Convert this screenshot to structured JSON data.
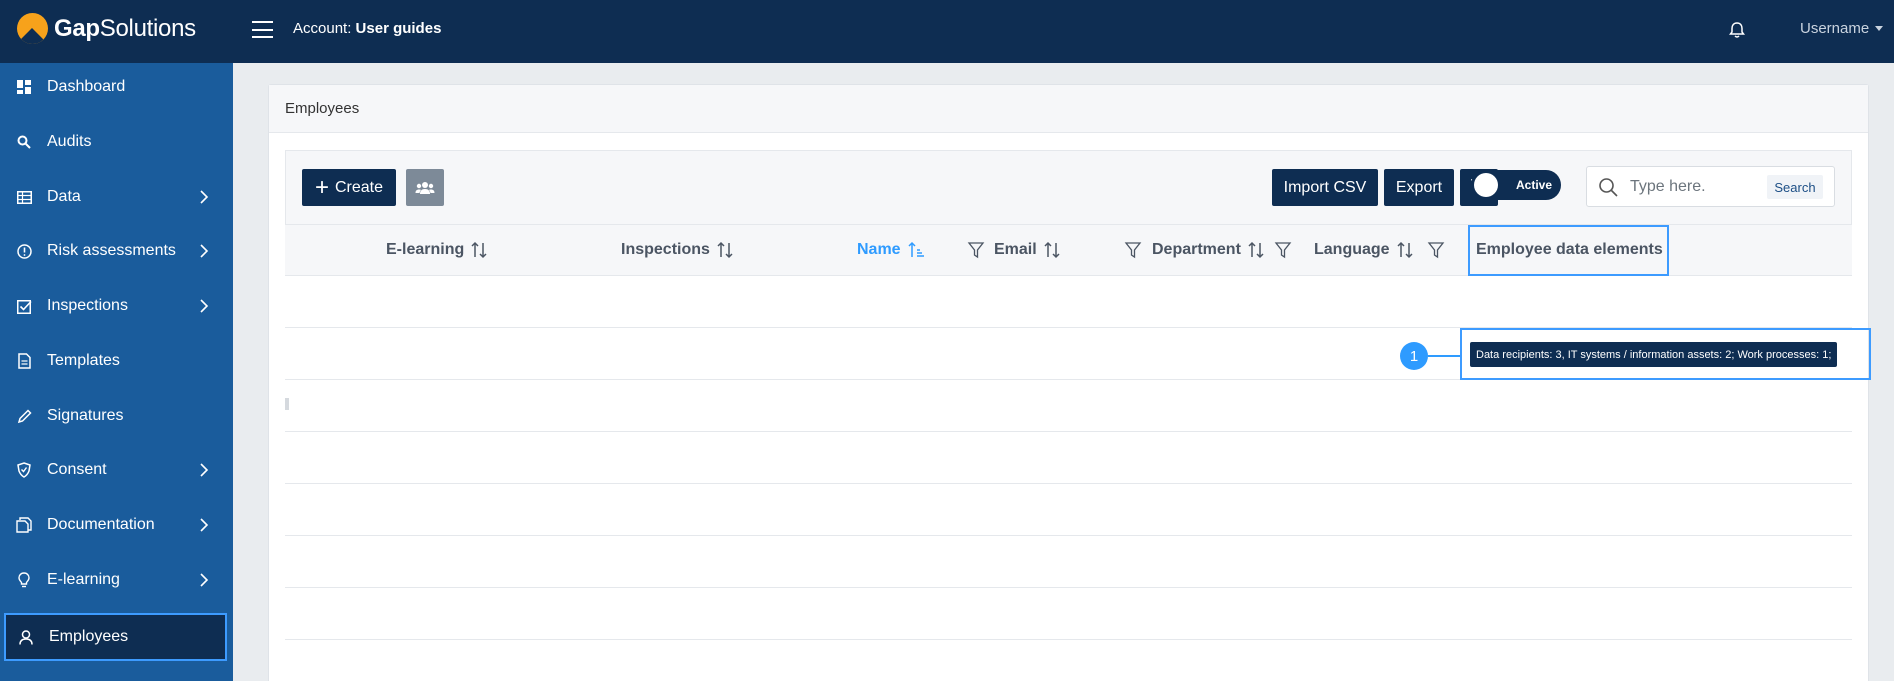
{
  "app": {
    "logo_bold": "Gap",
    "logo_rest": "Solutions",
    "account_prefix": "Account:",
    "account_name": "User guides",
    "username": "Username"
  },
  "sidebar": {
    "items": [
      {
        "label": "Dashboard",
        "icon": "dashboard-icon",
        "chevron": false
      },
      {
        "label": "Audits",
        "icon": "search-icon",
        "chevron": false
      },
      {
        "label": "Data",
        "icon": "table-icon",
        "chevron": true
      },
      {
        "label": "Risk assessments",
        "icon": "alert-circle-icon",
        "chevron": true
      },
      {
        "label": "Inspections",
        "icon": "checkbox-icon",
        "chevron": true
      },
      {
        "label": "Templates",
        "icon": "document-icon",
        "chevron": false
      },
      {
        "label": "Signatures",
        "icon": "pen-icon",
        "chevron": false
      },
      {
        "label": "Consent",
        "icon": "shield-icon",
        "chevron": true
      },
      {
        "label": "Documentation",
        "icon": "documents-icon",
        "chevron": true
      },
      {
        "label": "E-learning",
        "icon": "lightbulb-icon",
        "chevron": true
      },
      {
        "label": "Employees",
        "icon": "user-icon",
        "chevron": false,
        "active": true
      }
    ]
  },
  "panel": {
    "title": "Employees"
  },
  "toolbar": {
    "create_label": "Create",
    "import_label": "Import CSV",
    "export_label": "Export",
    "toggle_label": "Active",
    "search_placeholder": "Type here.",
    "search_button": "Search"
  },
  "table": {
    "columns": [
      {
        "label": "E-learning",
        "sort": "none"
      },
      {
        "label": "Inspections",
        "sort": "none"
      },
      {
        "label": "Name",
        "sort": "ascending"
      },
      {
        "label": "Email",
        "sort": "none"
      },
      {
        "label": "Department",
        "sort": "none"
      },
      {
        "label": "Language",
        "sort": "none"
      },
      {
        "label": "Employee data elements",
        "sort": "none"
      }
    ],
    "callout_number": "1",
    "tooltip_text": "Data recipients: 3, IT systems / information assets: 2; Work processes: 1;"
  },
  "colors": {
    "topbar": "#0e2d52",
    "sidebar": "#1a5c9c",
    "highlight": "#3d9bff",
    "logo": "#f7a21b"
  }
}
